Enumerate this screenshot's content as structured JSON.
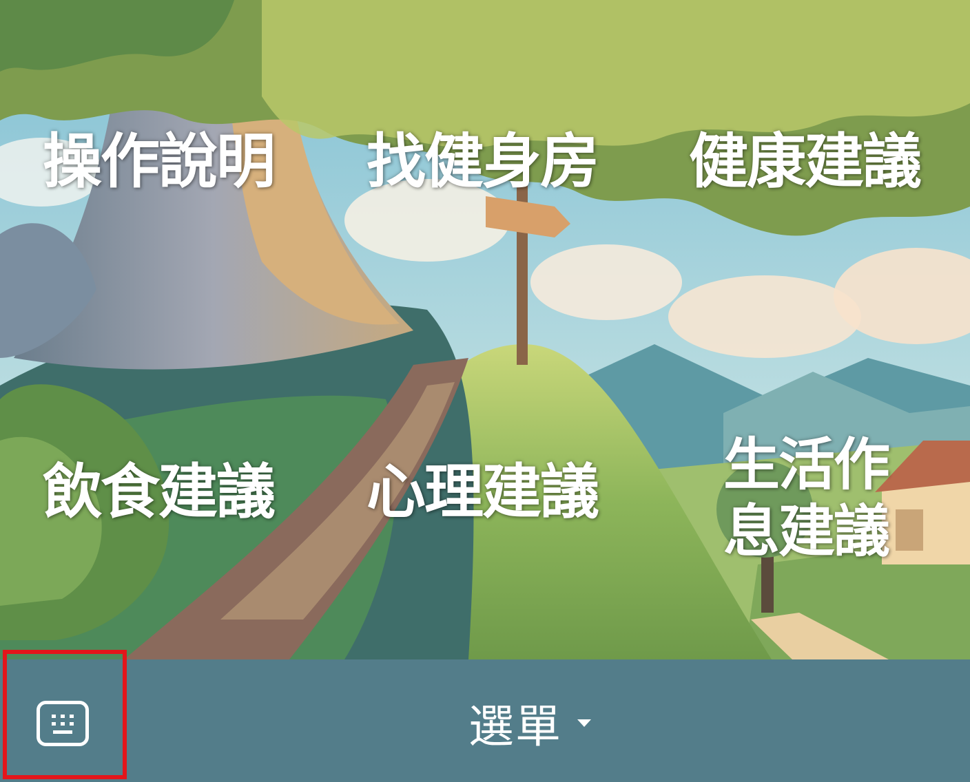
{
  "rich_menu": {
    "items": [
      {
        "label": "操作說明"
      },
      {
        "label": "找健身房"
      },
      {
        "label": "健康建議"
      },
      {
        "label": "飲食建議"
      },
      {
        "label": "心理建議"
      },
      {
        "label": "生活作息建議"
      }
    ]
  },
  "bottom_bar": {
    "menu_label": "選單",
    "keyboard_icon": "keyboard-icon",
    "caret_icon": "caret-down-icon"
  },
  "colors": {
    "bar": "#537d8a",
    "highlight": "#e3151b",
    "text": "#ffffff"
  }
}
